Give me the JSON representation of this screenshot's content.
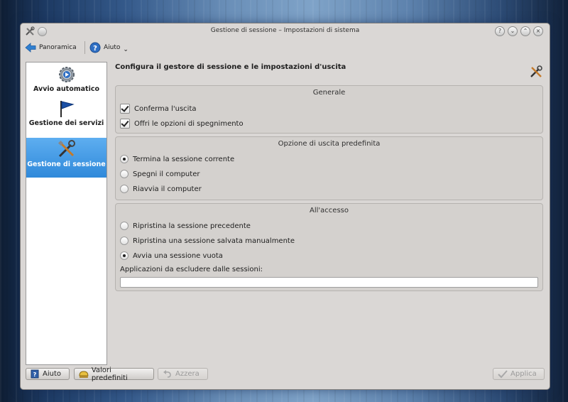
{
  "window": {
    "title": "Gestione di sessione – Impostazioni di sistema"
  },
  "toolbar": {
    "overview_label": "Panoramica",
    "help_label": "Aiuto"
  },
  "sidebar": {
    "items": [
      {
        "label": "Avvio automatico",
        "icon": "gear-icon",
        "selected": false
      },
      {
        "label": "Gestione dei servizi",
        "icon": "flag-icon",
        "selected": false
      },
      {
        "label": "Gestione di sessione",
        "icon": "tools-icon",
        "selected": true
      }
    ]
  },
  "main": {
    "heading": "Configura il gestore di sessione e le impostazioni d'uscita",
    "general": {
      "title": "Generale",
      "confirm_logout": "Conferma l'uscita",
      "offer_shutdown": "Offri le opzioni di spegnimento"
    },
    "default_exit": {
      "title": "Opzione di uscita predefinita",
      "options": [
        {
          "label": "Termina la sessione corrente",
          "selected": true
        },
        {
          "label": "Spegni il computer",
          "selected": false
        },
        {
          "label": "Riavvia il computer",
          "selected": false
        }
      ]
    },
    "on_login": {
      "title": "All'accesso",
      "options": [
        {
          "label": "Ripristina la sessione precedente",
          "selected": false
        },
        {
          "label": "Ripristina una sessione salvata manualmente",
          "selected": false
        },
        {
          "label": "Avvia una sessione vuota",
          "selected": true
        }
      ],
      "exclude_label": "Applicazioni da escludere dalle sessioni:",
      "exclude_value": ""
    }
  },
  "buttons": {
    "help": "Aiuto",
    "defaults": "Valori predefiniti",
    "reset": "Azzera",
    "apply": "Applica"
  },
  "colors": {
    "selection": "#3a90dd",
    "window_bg": "#dad7d5"
  }
}
